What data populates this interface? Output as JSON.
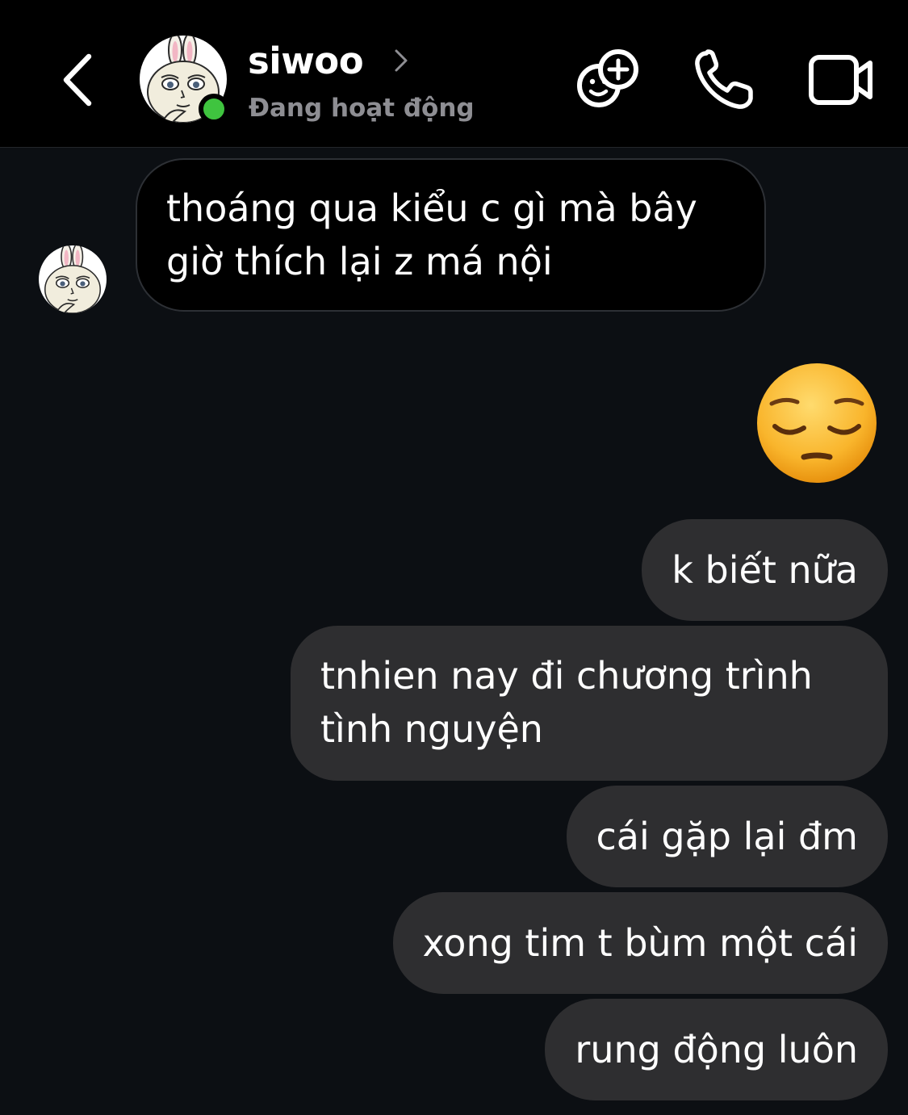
{
  "header": {
    "contact_name": "siwoo",
    "status": "Đang hoạt động",
    "online_color": "#3fc43f",
    "icons": {
      "back": "chevron-left-icon",
      "effects": "effects-plus-icon",
      "call": "phone-icon",
      "video": "video-camera-icon"
    }
  },
  "messages": [
    {
      "direction": "incoming",
      "lines": [
        "thoáng qua kiểu c gì mà bây",
        "giờ thích lại z má nội"
      ]
    },
    {
      "direction": "outgoing",
      "type": "emoji",
      "emoji": "pensive-face"
    },
    {
      "direction": "outgoing",
      "text": "k biết nữa"
    },
    {
      "direction": "outgoing",
      "lines": [
        "tnhien nay đi chương trình",
        "tình nguyện"
      ]
    },
    {
      "direction": "outgoing",
      "text": "cái gặp lại đm"
    },
    {
      "direction": "outgoing",
      "text": "xong tim t bùm một cái"
    },
    {
      "direction": "outgoing",
      "text": "rung động luôn"
    }
  ],
  "theme": {
    "background": "#0c0f13",
    "header_background": "#000000",
    "incoming_bubble": "#000000",
    "outgoing_bubble": "#2e2e30"
  }
}
